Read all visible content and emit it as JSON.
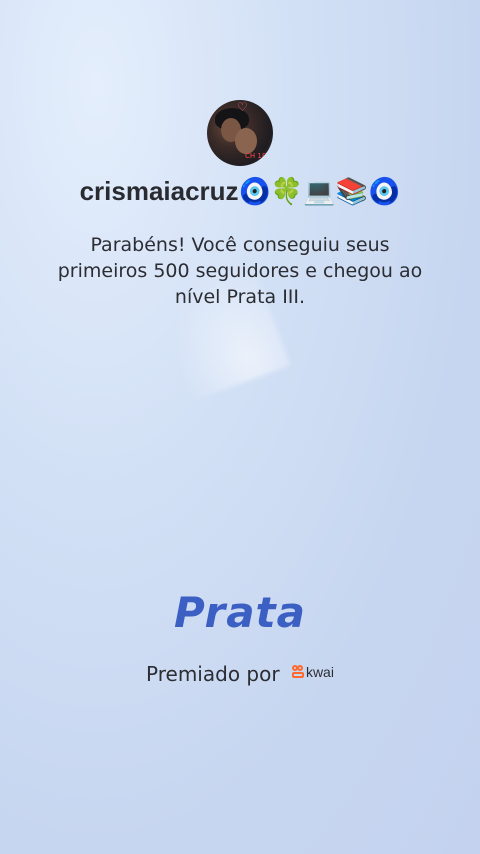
{
  "profile": {
    "username": "crismaiacruz🧿🍀💻📚🧿",
    "avatar_icon": "user-avatar-photo",
    "heart_icon": "♡"
  },
  "message": "Parabéns! Você conseguiu seus primeiros 500 seguidores e chegou ao nível Prata III.",
  "level": {
    "title": "Prata"
  },
  "footer": {
    "awarded_by": "Premiado por",
    "brand": "kwai",
    "brand_color": "#ff6a2b"
  },
  "colors": {
    "level_title": "#3b5fc2",
    "background": "#c9d8f2"
  }
}
